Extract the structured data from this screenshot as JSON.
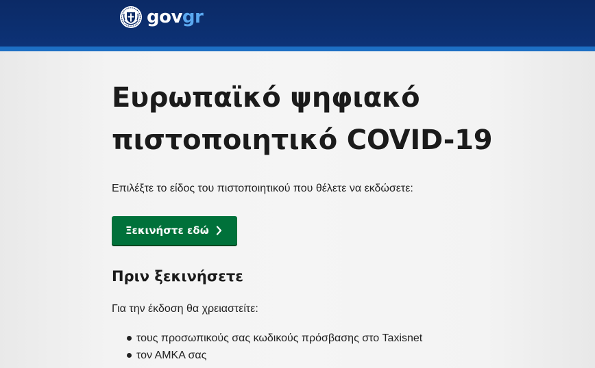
{
  "header": {
    "logo_prefix": "gov",
    "logo_suffix": "gr",
    "colors": {
      "background": "#0b2a66",
      "stripe": "#1d6fc4",
      "logo_accent": "#5aa8f0"
    },
    "emblem_icon": "greek-coat-of-arms-icon"
  },
  "main": {
    "title_line1": "Ευρωπαϊκό ψηφιακό",
    "title_line2": "πιστοποιητικό COVID-19",
    "intro": "Επιλέξτε το είδος του πιστοποιητικού που θέλετε να εκδώσετε:",
    "start_button": {
      "label": "Ξεκινήστε εδώ",
      "icon": "chevron-right-icon",
      "color": "#00713a"
    },
    "before_heading": "Πριν ξεκινήσετε",
    "need_text": "Για την έκδοση θα χρειαστείτε:",
    "requirements": [
      "τους προσωπικούς σας κωδικούς πρόσβασης στο Taxisnet",
      "τον ΑΜΚΑ σας"
    ]
  }
}
